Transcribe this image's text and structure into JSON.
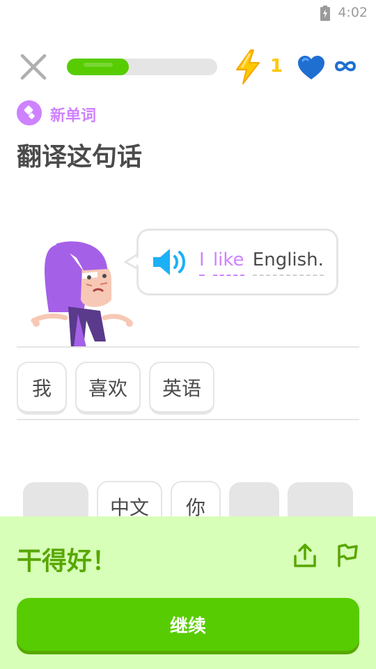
{
  "status_bar": {
    "time": "4:02",
    "battery_icon": "battery-charging-icon"
  },
  "header": {
    "close_icon": "close-icon",
    "progress_fraction": 0.41,
    "energy_icon": "lightning-bolt-icon",
    "energy_count": "1",
    "hearts_icon": "heart-icon",
    "hearts_value": "infinity-icon"
  },
  "lesson": {
    "badge_icon": "new-word-badge-icon",
    "badge_label": "新单词",
    "title": "翻译这句话",
    "speaker_icon": "speaker-icon",
    "sentence": [
      {
        "text": "I",
        "new": true
      },
      {
        "text": "like",
        "new": true
      },
      {
        "text": "English.",
        "new": false
      }
    ]
  },
  "answer_chips": [
    "我",
    "喜欢",
    "英语"
  ],
  "word_bank": [
    {
      "text": "",
      "used": true
    },
    {
      "text": "中文",
      "used": false
    },
    {
      "text": "你",
      "used": false
    },
    {
      "text": "",
      "used": true
    },
    {
      "text": "",
      "used": true
    }
  ],
  "feedback": {
    "title": "干得好！",
    "share_icon": "share-icon",
    "report_icon": "flag-icon",
    "continue_label": "继续"
  },
  "colors": {
    "accent_green": "#58cc02",
    "feedback_bg": "#d7ffb8",
    "new_word_purple": "#ce82ff",
    "heart_blue": "#1cb0f6",
    "bolt_yellow": "#ffc800"
  }
}
